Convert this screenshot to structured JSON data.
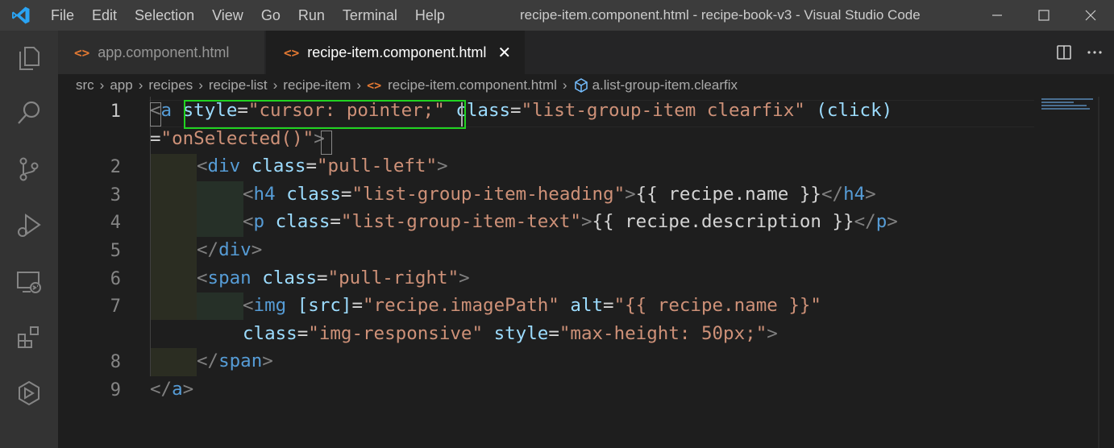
{
  "menu": [
    "File",
    "Edit",
    "Selection",
    "View",
    "Go",
    "Run",
    "Terminal",
    "Help"
  ],
  "window_title": "recipe-item.component.html - recipe-book-v3 - Visual Studio Code",
  "tabs": [
    {
      "label": "app.component.html",
      "icon": "html-file-icon"
    },
    {
      "label": "recipe-item.component.html",
      "icon": "html-file-icon",
      "close": "✕"
    }
  ],
  "breadcrumb": [
    "src",
    "app",
    "recipes",
    "recipe-list",
    "recipe-item",
    "recipe-item.component.html",
    "a.list-group-item.clearfix"
  ],
  "line_numbers": [
    "1",
    "2",
    "3",
    "4",
    "5",
    "6",
    "7",
    "8",
    "9"
  ],
  "code": {
    "l1_open": "<",
    "l1_tag": "a",
    "l1_attr1": "style",
    "l1_eq1": "=",
    "l1_val1": "\"cursor: pointer;\"",
    "l1_attr2": "class",
    "l1_eq2": "=",
    "l1_val2": "\"list-group-item clearfix\"",
    "l1_attr3": "(click)",
    "l1b_eq": "=",
    "l1b_val": "\"onSelected()\"",
    "l1b_close": ">",
    "l2_tag": "div",
    "l2_attr": "class",
    "l2_val": "\"pull-left\"",
    "l3_tag": "h4",
    "l3_attr": "class",
    "l3_val": "\"list-group-item-heading\"",
    "l3_text": "{{ recipe.name }}",
    "l3_end": "h4",
    "l4_tag": "p",
    "l4_attr": "class",
    "l4_val": "\"list-group-item-text\"",
    "l4_text": "{{ recipe.description }}",
    "l4_end": "p",
    "l5_end": "div",
    "l6_tag": "span",
    "l6_attr": "class",
    "l6_val": "\"pull-right\"",
    "l7_tag": "img",
    "l7_attr1": "[src]",
    "l7_val1": "\"recipe.imagePath\"",
    "l7_attr2": "alt",
    "l7_val2": "\"{{ recipe.name }}\"",
    "l7b_attr1": "class",
    "l7b_val1": "\"img-responsive\"",
    "l7b_attr2": "style",
    "l7b_val2": "\"max-height: 50px;\"",
    "l8_end": "span",
    "l9_end": "a"
  },
  "colors": {
    "accent_highlight": "#21d321",
    "tag": "#569cd6",
    "attribute": "#9cdcfe",
    "string": "#ce9178"
  }
}
